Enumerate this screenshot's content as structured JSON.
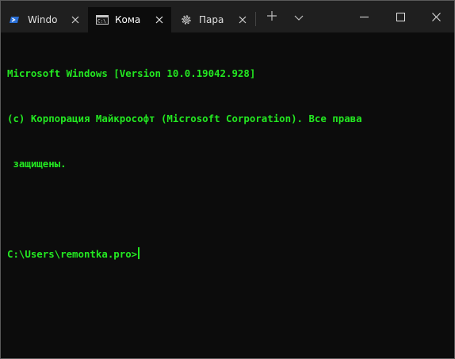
{
  "tabs": [
    {
      "label": "Windo",
      "icon": "powershell-icon",
      "active": false
    },
    {
      "label": "Кома",
      "icon": "cmd-icon",
      "active": true
    },
    {
      "label": "Пара",
      "icon": "gear-icon",
      "active": false
    }
  ],
  "terminal": {
    "lines": [
      "Microsoft Windows [Version 10.0.19042.928]",
      "(c) Корпорация Майкрософт (Microsoft Corporation). Все права",
      " защищены.",
      "",
      "C:\\Users\\remontka.pro>"
    ],
    "text_color": "#23e821",
    "background": "#0c0c0c"
  },
  "colors": {
    "titlebar": "#1f1f1f",
    "active_tab": "#0c0c0c"
  }
}
